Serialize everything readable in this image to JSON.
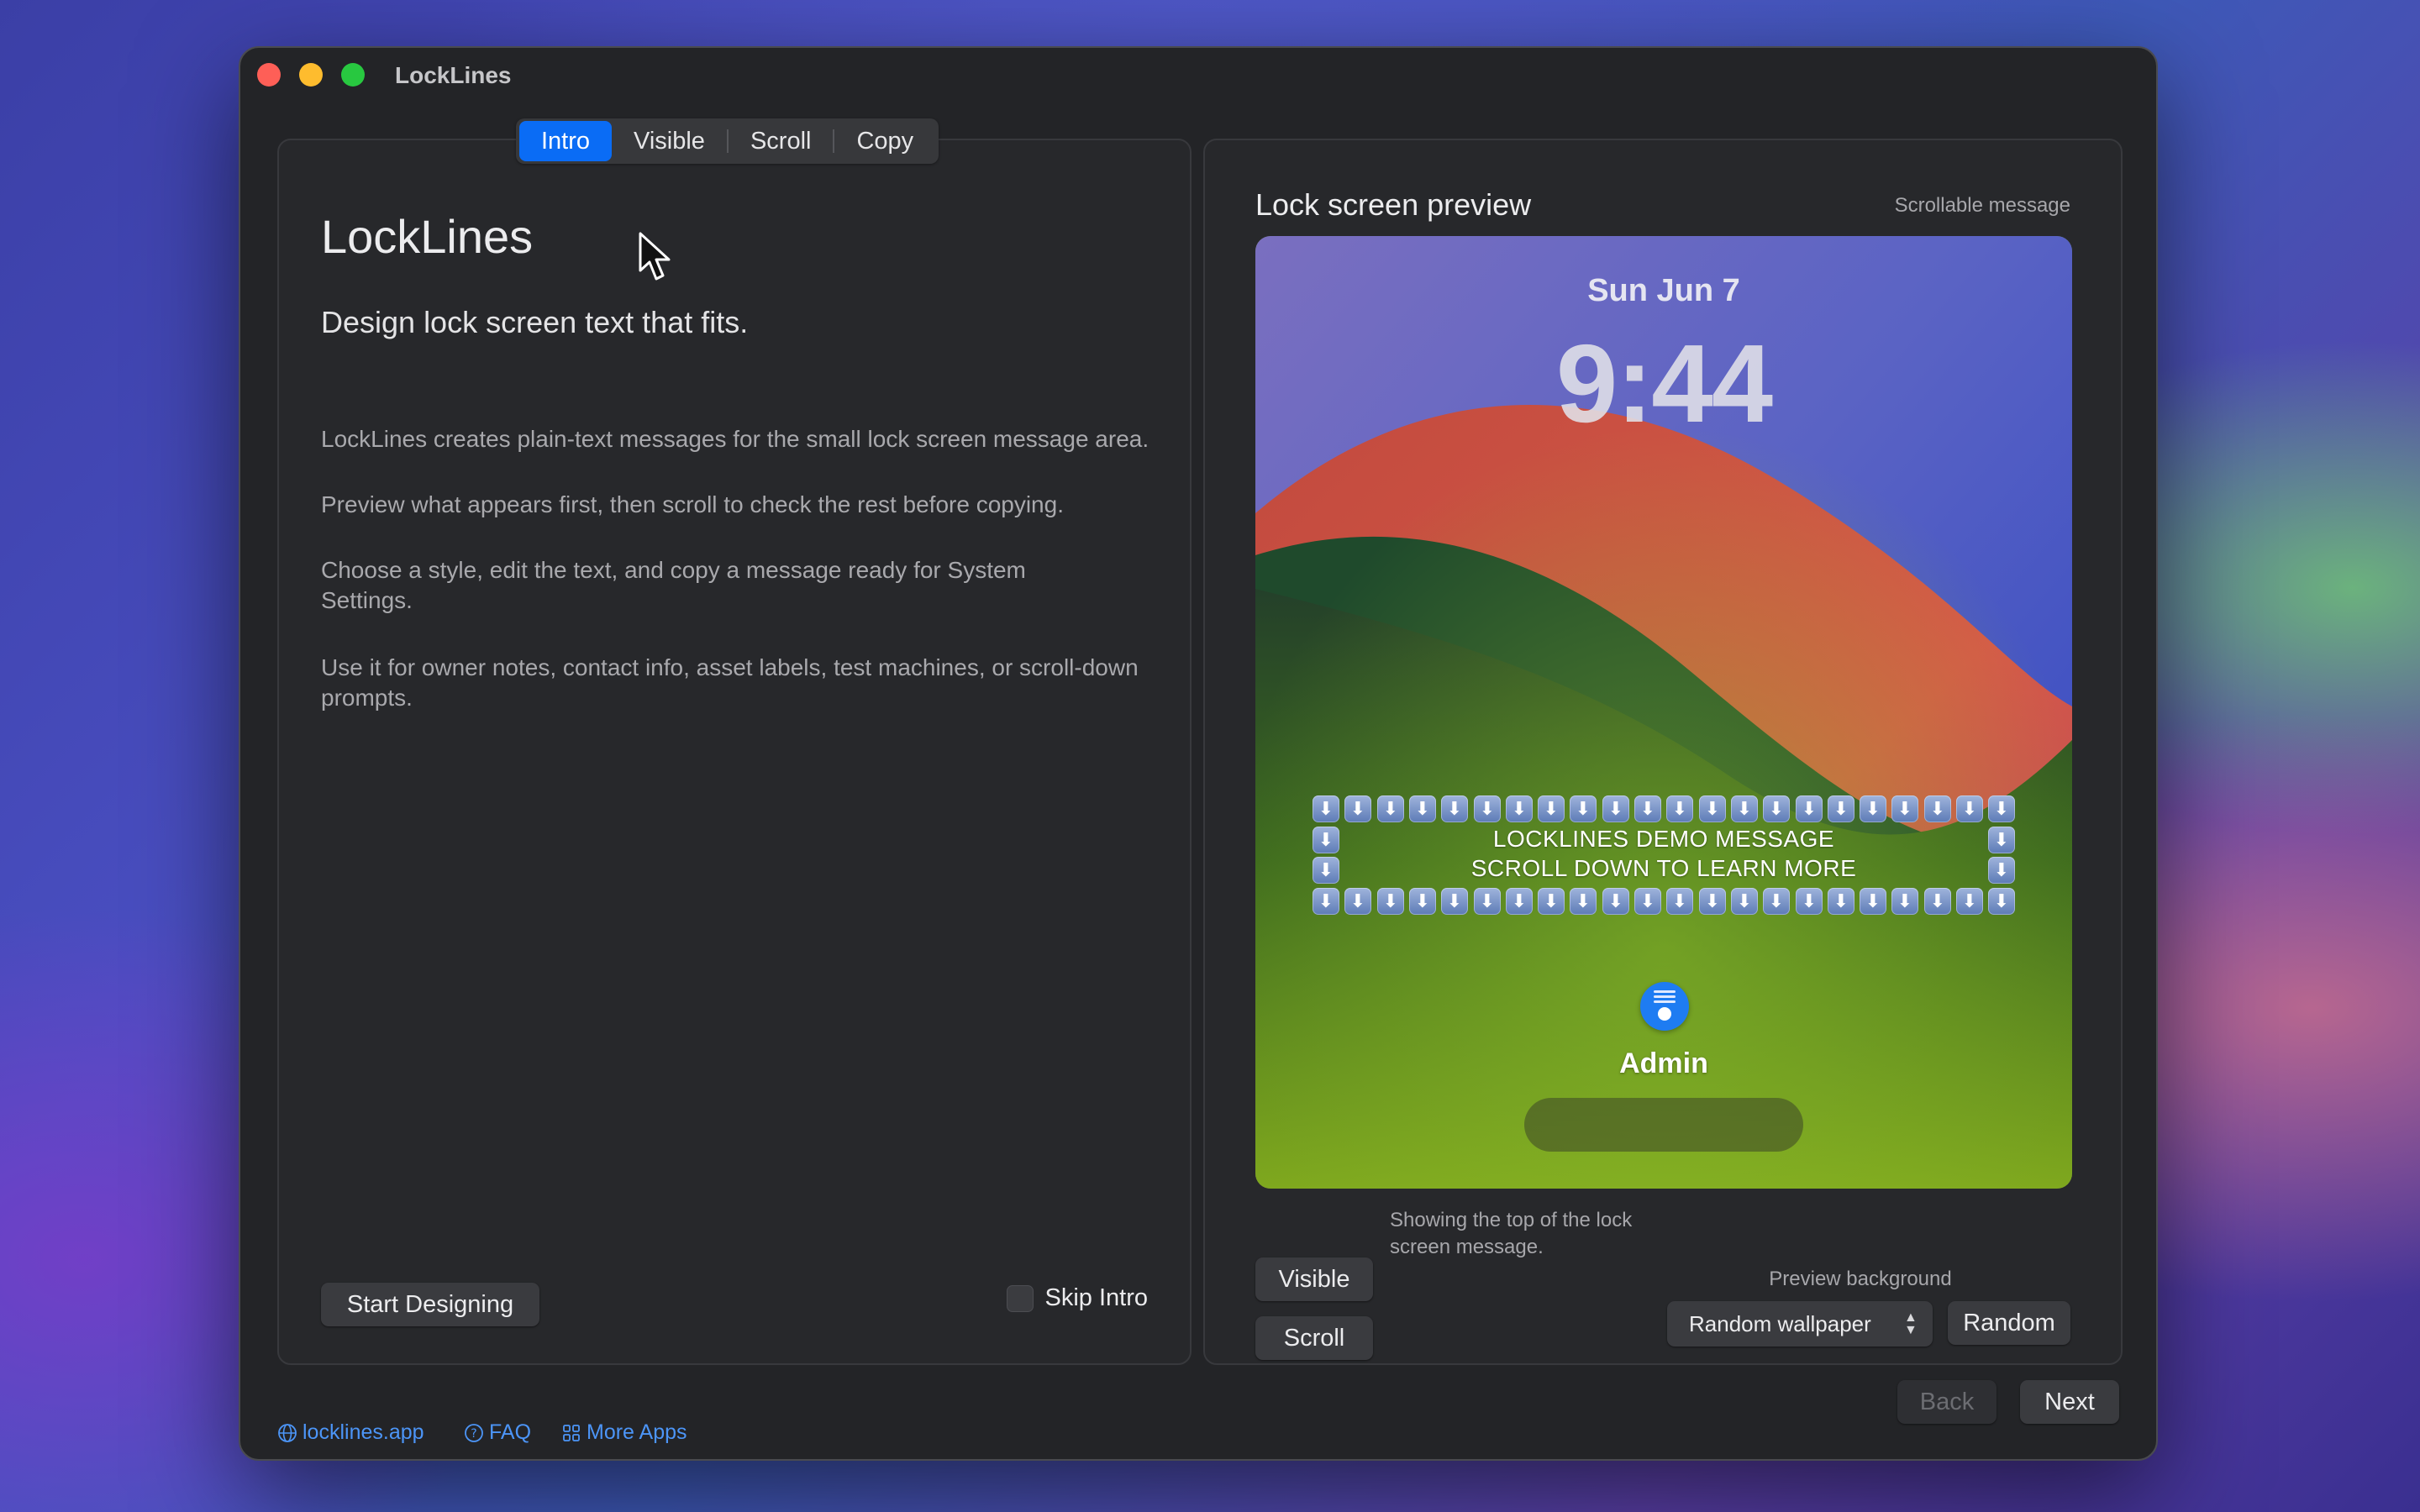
{
  "window": {
    "title": "LockLines"
  },
  "tabs": [
    "Intro",
    "Visible",
    "Scroll",
    "Copy"
  ],
  "intro": {
    "heading": "LockLines",
    "tagline": "Design lock screen text that fits.",
    "paragraphs": [
      "LockLines creates plain-text messages for the small lock screen message area.",
      "Preview what appears first, then scroll to check the rest before copying.",
      "Choose a style, edit the text, and copy a message ready for System Settings.",
      "Use it for owner notes, contact info, asset labels, test machines, or scroll-down prompts."
    ],
    "start_button": "Start Designing",
    "skip_label": "Skip Intro",
    "skip_checked": false
  },
  "preview": {
    "title": "Lock screen preview",
    "subtitle": "Scrollable message",
    "date": "Sun Jun 7",
    "time": "9:44",
    "message_lines": [
      "LOCKLINES DEMO MESSAGE",
      "SCROLL DOWN TO LEARN MORE"
    ],
    "border_emoji": "⬇",
    "user_name": "Admin",
    "visible_button": "Visible",
    "scroll_button": "Scroll",
    "caption": "Showing the top of the lock screen message.",
    "background_label": "Preview background",
    "background_value": "Random wallpaper",
    "random_button": "Random"
  },
  "footer": {
    "website": "locklines.app",
    "faq": "FAQ",
    "more_apps": "More Apps",
    "back": "Back",
    "next": "Next"
  },
  "colors": {
    "accent": "#0a6cf5",
    "link": "#4c95f7",
    "window_bg": "#232427",
    "panel_bg": "#27282b"
  }
}
